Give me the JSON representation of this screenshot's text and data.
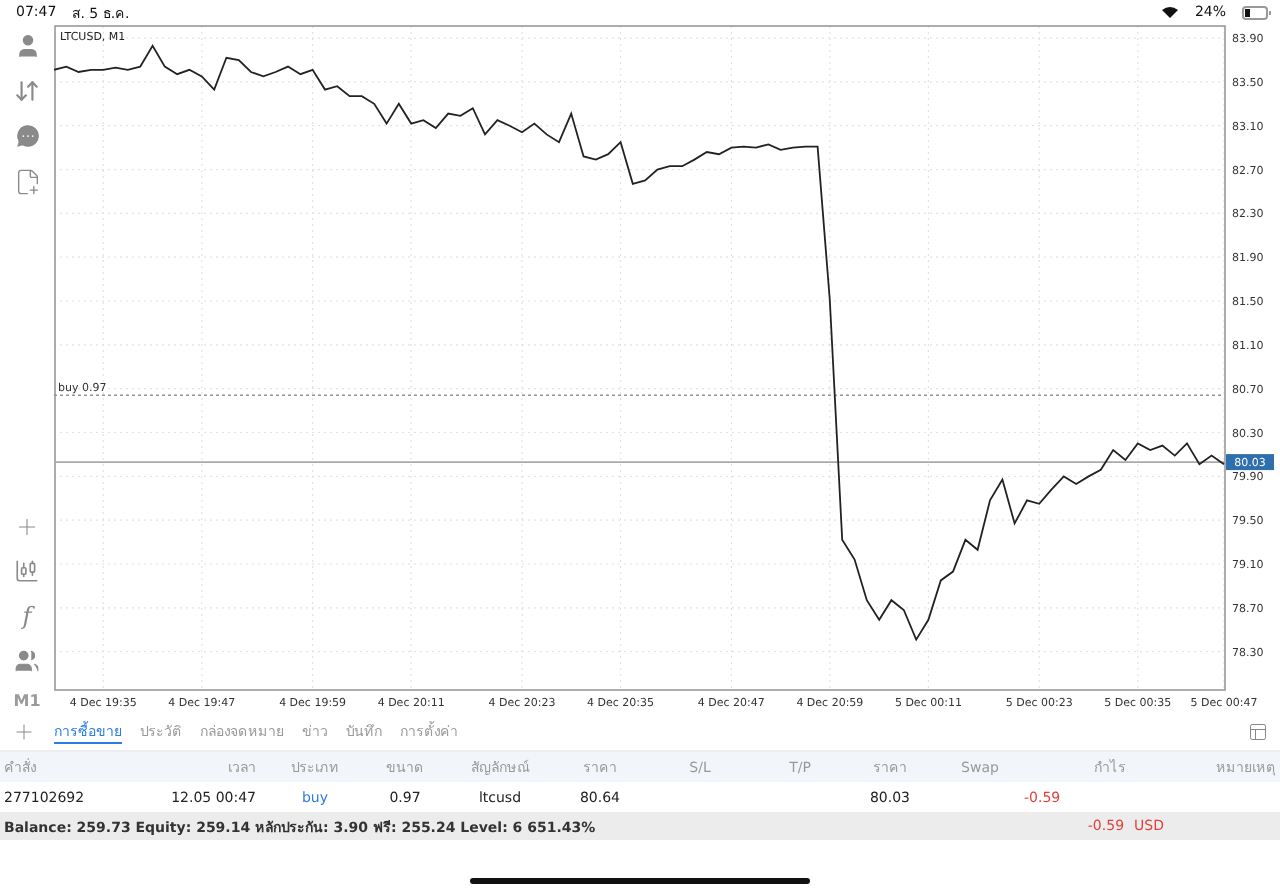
{
  "status_bar": {
    "time": "07:47",
    "date": "ส. 5 ธ.ค.",
    "battery": "24%"
  },
  "toolbar": {
    "function_label": "f",
    "timeframe": "M1"
  },
  "chart": {
    "chart_data": {
      "type": "line",
      "title": "LTCUSD, M1",
      "categories": [
        null,
        null,
        null,
        null,
        "4 Dec 19:35",
        null,
        null,
        null,
        null,
        null,
        null,
        null,
        "4 Dec 19:47",
        null,
        null,
        null,
        null,
        null,
        null,
        null,
        null,
        "4 Dec 19:59",
        null,
        null,
        null,
        null,
        null,
        null,
        null,
        "4 Dec 20:11",
        null,
        null,
        null,
        null,
        null,
        null,
        null,
        null,
        "4 Dec 20:23",
        null,
        null,
        null,
        null,
        null,
        null,
        null,
        "4 Dec 20:35",
        null,
        null,
        null,
        null,
        null,
        null,
        null,
        null,
        "4 Dec 20:47",
        null,
        null,
        null,
        null,
        null,
        null,
        null,
        "4 Dec 20:59",
        null,
        null,
        null,
        null,
        null,
        null,
        null,
        "5 Dec 00:11",
        null,
        null,
        null,
        null,
        null,
        null,
        null,
        null,
        "5 Dec 00:23",
        null,
        null,
        null,
        null,
        null,
        null,
        null,
        "5 Dec 00:35",
        null,
        null,
        null,
        null,
        null,
        null,
        "5 Dec 00:47"
      ],
      "series": [
        {
          "color": "#222222",
          "values": [
            83.61,
            83.64,
            83.59,
            83.61,
            83.61,
            83.63,
            83.61,
            83.64,
            83.83,
            83.64,
            83.57,
            83.61,
            83.55,
            83.43,
            83.72,
            83.7,
            83.59,
            83.55,
            83.59,
            83.64,
            83.57,
            83.61,
            83.43,
            83.46,
            83.37,
            83.37,
            83.3,
            83.12,
            83.3,
            83.12,
            83.15,
            83.08,
            83.21,
            83.19,
            83.26,
            83.02,
            83.15,
            83.1,
            83.04,
            83.12,
            83.02,
            82.95,
            83.21,
            82.82,
            82.79,
            82.84,
            82.95,
            82.57,
            82.6,
            82.7,
            82.73,
            82.73,
            82.79,
            82.86,
            82.84,
            82.9,
            82.91,
            82.9,
            82.93,
            82.88,
            82.9,
            82.91,
            82.91,
            81.51,
            79.32,
            79.14,
            78.77,
            78.59,
            78.77,
            78.68,
            78.41,
            78.59,
            78.95,
            79.03,
            79.32,
            79.23,
            79.68,
            79.87,
            79.47,
            79.68,
            79.65,
            79.78,
            79.9,
            79.83,
            79.9,
            79.96,
            80.14,
            80.05,
            80.2,
            80.14,
            80.18,
            80.09,
            80.2,
            80.01,
            80.09,
            80.01
          ]
        }
      ],
      "grid": true,
      "ylim": [
        77.95,
        84.01
      ],
      "yticks": [
        {
          "value": 83.9,
          "label": "83.90"
        },
        {
          "value": 83.5,
          "label": "83.50"
        },
        {
          "value": 83.1,
          "label": "83.10"
        },
        {
          "value": 82.7,
          "label": "82.70"
        },
        {
          "value": 82.3,
          "label": "82.30"
        },
        {
          "value": 81.9,
          "label": "81.90"
        },
        {
          "value": 81.5,
          "label": "81.50"
        },
        {
          "value": 81.1,
          "label": "81.10"
        },
        {
          "value": 80.7,
          "label": "80.70"
        },
        {
          "value": 80.3,
          "label": "80.30"
        },
        {
          "value": 79.9,
          "label": "79.90"
        },
        {
          "value": 79.5,
          "label": "79.50"
        },
        {
          "value": 79.1,
          "label": "79.10"
        },
        {
          "value": 78.7,
          "label": "78.70"
        },
        {
          "value": 78.3,
          "label": "78.30"
        }
      ],
      "ref_lines": [
        {
          "axis": "y",
          "value": 80.64,
          "label": "buy 0.97"
        },
        {
          "axis": "y",
          "value": 80.03,
          "label": "80.03"
        }
      ]
    }
  },
  "tabs": [
    {
      "label": "การซื้อขาย",
      "selected": true
    },
    {
      "label": "ประวัติ",
      "selected": false
    },
    {
      "label": "กล่องจดหมาย",
      "selected": false
    },
    {
      "label": "ข่าว",
      "selected": false
    },
    {
      "label": "บันทึก",
      "selected": false
    },
    {
      "label": "การตั้งค่า",
      "selected": false
    }
  ],
  "table": {
    "columns": [
      "คำสั่ง",
      "เวลา",
      "ประเภท",
      "ขนาด",
      "สัญลักษณ์",
      "ราคา",
      "S/L",
      "T/P",
      "ราคา",
      "Swap",
      "กำไร",
      "หมายเหตุ"
    ],
    "rows": [
      {
        "cells": [
          "277102692",
          "12.05 00:47",
          "buy",
          "0.97",
          "ltcusd",
          "80.64",
          null,
          null,
          "80.03",
          null,
          "-0.59",
          null
        ]
      }
    ]
  },
  "summary": {
    "text": "Balance: 259.73 Equity: 259.14 หลักประกัน: 3.90 ฟรี: 255.24 Level: 6 651.43%",
    "profit": "-0.59",
    "currency": "USD"
  }
}
